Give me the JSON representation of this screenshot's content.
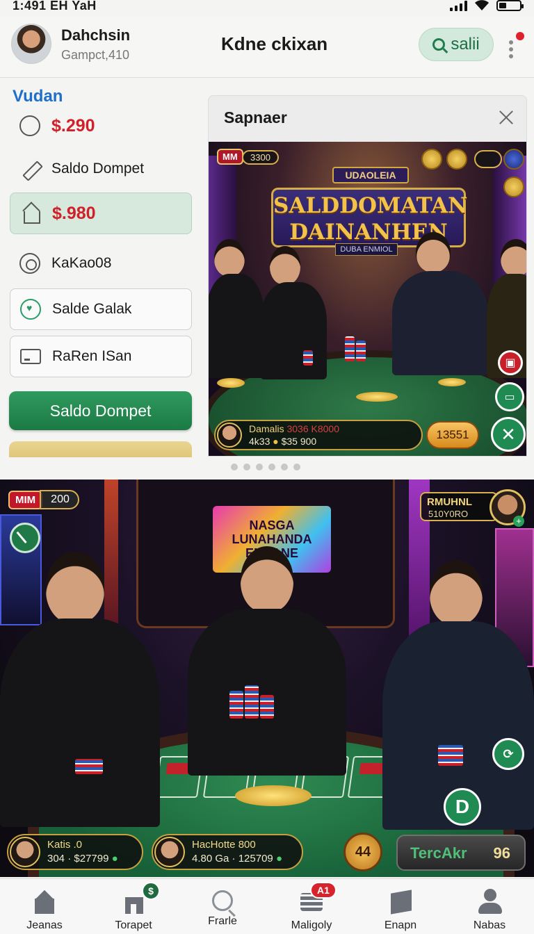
{
  "status": {
    "time": "1:491 EH YaH"
  },
  "header": {
    "user_name": "Dahchsin",
    "user_sub": "Gampct,410",
    "title": "Kdne ckixan",
    "search_label": "salii"
  },
  "menu": {
    "section": "Vudan",
    "items": [
      {
        "label": "$.290",
        "icon": "face-icon",
        "kind": "amount"
      },
      {
        "label": "Saldo Dompet",
        "icon": "pencil-icon",
        "kind": "text"
      },
      {
        "label": "$.980",
        "icon": "house-icon",
        "kind": "amount"
      },
      {
        "label": "KaKao08",
        "icon": "chat-icon",
        "kind": "text"
      },
      {
        "label": "Salde Galak",
        "icon": "heart-icon",
        "kind": "text"
      },
      {
        "label": "RaRen ISan",
        "icon": "card-icon",
        "kind": "text"
      }
    ],
    "cta": "Saldo Dompet"
  },
  "popup": {
    "title": "Sapnaer",
    "badge": "MM",
    "badge_value": "3300",
    "banner_sub": "UDAOLEIA",
    "banner_line1": "SALDDOMATAN",
    "banner_line2": "DAINANHEN",
    "banner_tag": "DUBA ENMIOL",
    "player_name": "Damalis",
    "player_extra": "3036 K8000",
    "player_level": "4k33",
    "player_chips": "$35 900",
    "gold_value": "13551"
  },
  "game": {
    "badge": "MIM",
    "badge_value": "200",
    "screen_text": "NASGA LUNAHANDA ENNANE",
    "right_name": "RMUHNL",
    "right_value": "510Y0RO",
    "player1_name": "Katis .0",
    "player1_value": "304 · $27799",
    "player2_name": "HacHotte 800",
    "player2_value": "4.80 Ga · 125709",
    "coin": "44",
    "score_label": "TercAkr",
    "score_value": "96"
  },
  "nav": [
    {
      "label": "Jeanas",
      "icon": "home-icon"
    },
    {
      "label": "Torapet",
      "icon": "store-icon",
      "badge": "$"
    },
    {
      "label": "Frarle",
      "icon": "search-icon"
    },
    {
      "label": "Maligoly",
      "icon": "stack-icon",
      "badge": "A1"
    },
    {
      "label": "Enapn",
      "icon": "box-icon"
    },
    {
      "label": "Nabas",
      "icon": "user-icon"
    }
  ],
  "colors": {
    "accent_green": "#1b7a44",
    "link_blue": "#1e6fc9",
    "amount_red": "#d0202a",
    "gold": "#d6ad45"
  }
}
